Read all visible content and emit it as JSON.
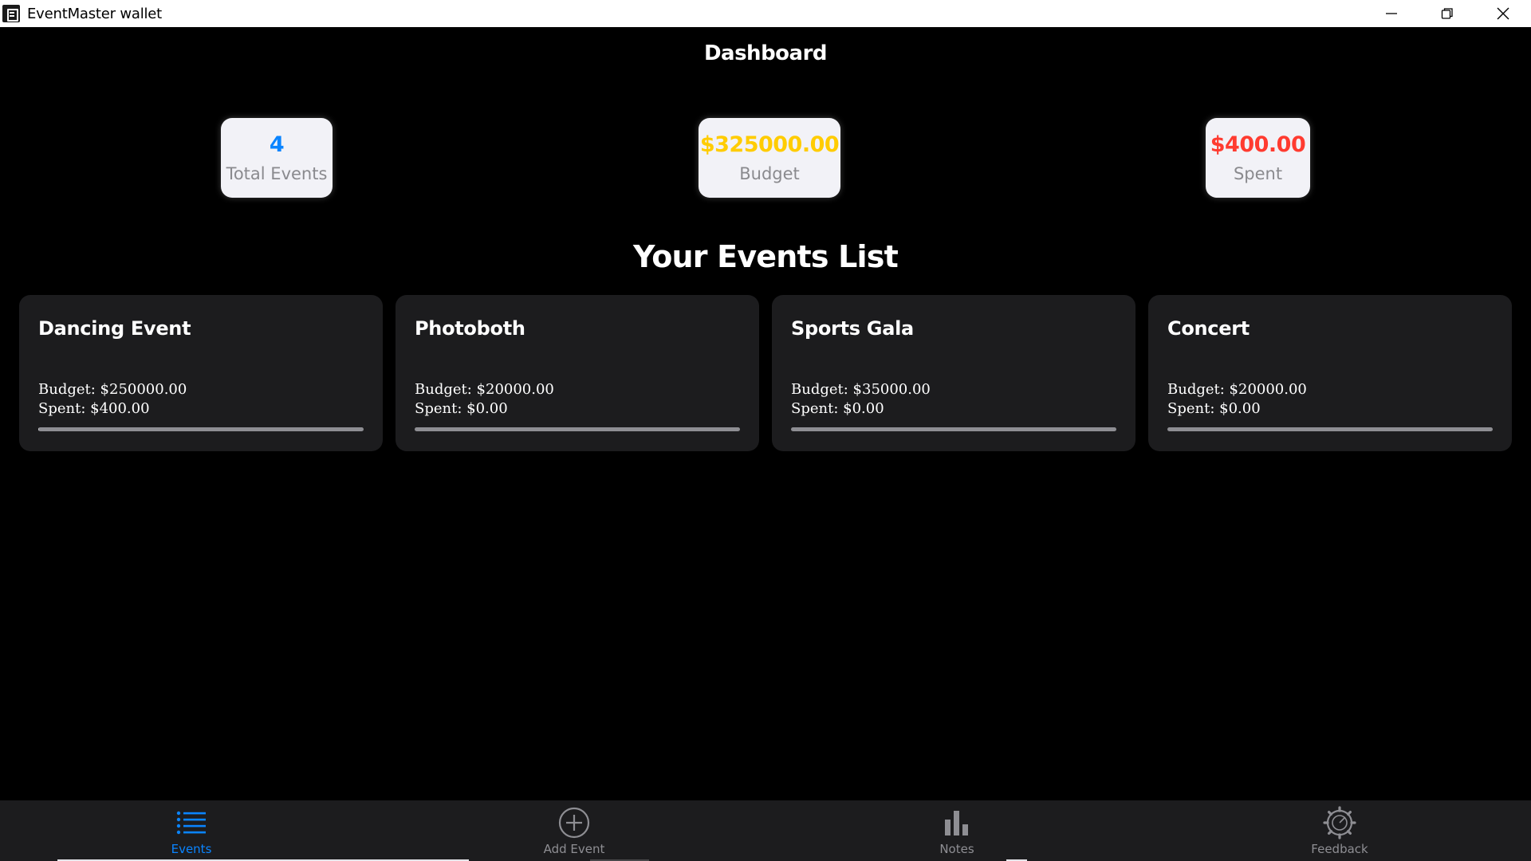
{
  "window": {
    "title": "EventMaster wallet",
    "controls": [
      "minimize-icon",
      "restore-icon",
      "close-icon"
    ]
  },
  "header": {
    "title": "Dashboard"
  },
  "stats": [
    {
      "value": "4",
      "label": "Total Events",
      "color": "#0a84ff"
    },
    {
      "value": "$325000.00",
      "label": "Budget",
      "color": "#ffcc00"
    },
    {
      "value": "$400.00",
      "label": "Spent",
      "color": "#ff3b30"
    }
  ],
  "events_section": {
    "title": "Your Events List"
  },
  "events": [
    {
      "name": "Dancing Event",
      "budget": "Budget: $250000.00",
      "spent": "Spent: $400.00",
      "progress": 0.0016
    },
    {
      "name": "Photoboth",
      "budget": "Budget: $20000.00",
      "spent": "Spent: $0.00",
      "progress": 0
    },
    {
      "name": "Sports Gala",
      "budget": "Budget: $35000.00",
      "spent": "Spent: $0.00",
      "progress": 0
    },
    {
      "name": "Concert",
      "budget": "Budget: $20000.00",
      "spent": "Spent: $0.00",
      "progress": 0
    }
  ],
  "nav": {
    "active": 0,
    "items": [
      {
        "label": "Events",
        "icon": "list-icon"
      },
      {
        "label": "Add Event",
        "icon": "add-circle-icon"
      },
      {
        "label": "Notes",
        "icon": "bar-chart-icon"
      },
      {
        "label": "Feedback",
        "icon": "gear-icon"
      }
    ]
  },
  "colors": {
    "accent": "#0a84ff",
    "budget": "#ffcc00",
    "spent": "#ff3b30",
    "card": "#1c1c1e"
  }
}
